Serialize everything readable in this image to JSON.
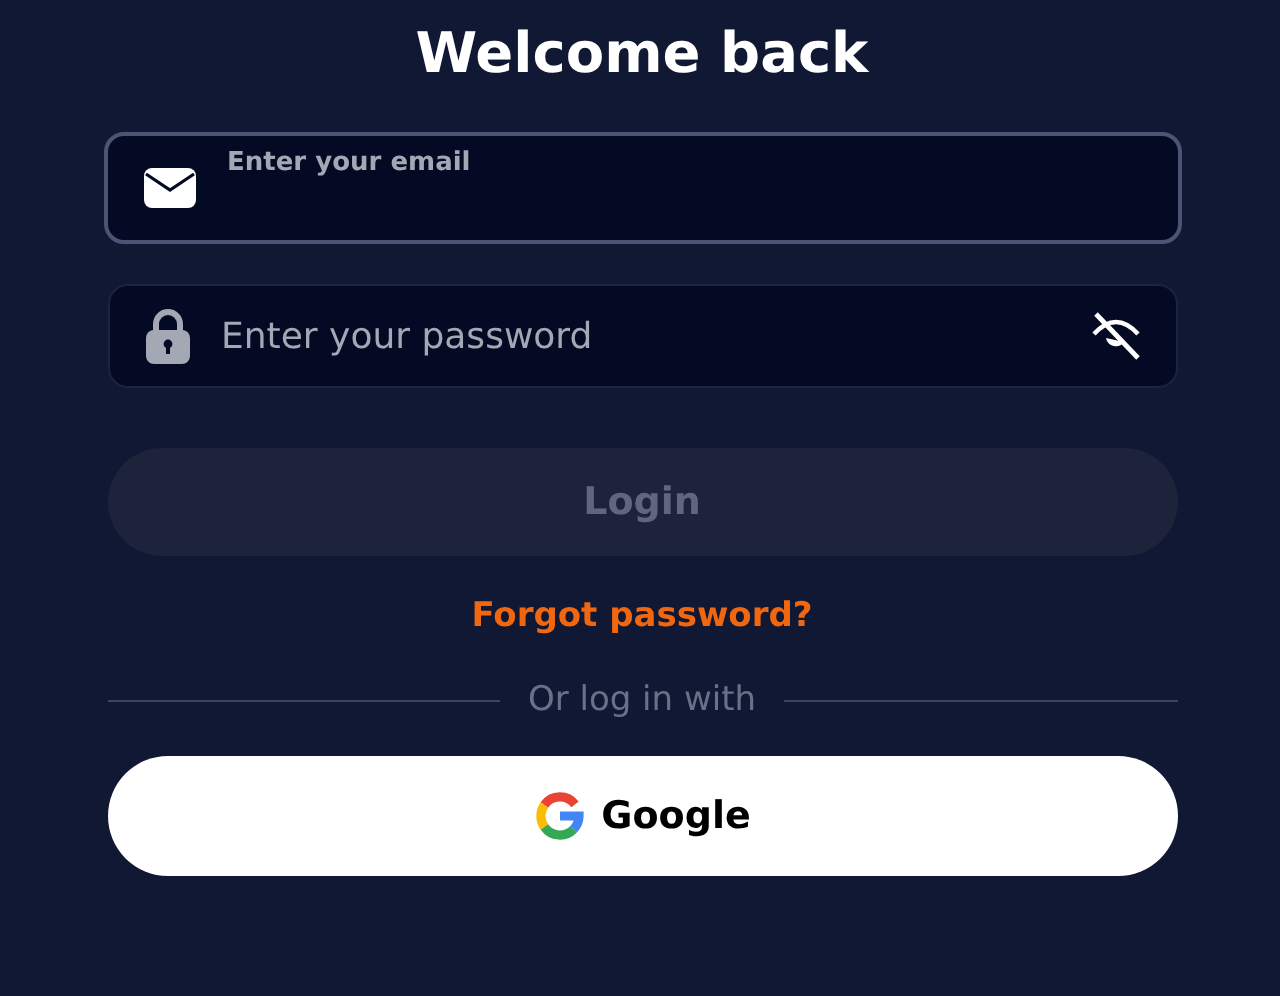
{
  "heading": "Welcome back",
  "email_field": {
    "label": "Enter your email",
    "focused": true
  },
  "password_field": {
    "placeholder": "Enter your password",
    "password_visible": false
  },
  "login_button": {
    "label": "Login",
    "disabled": true
  },
  "forgot_link": "Forgot password?",
  "divider_text": "Or log in with",
  "social_buttons": [
    {
      "kind": "google",
      "label": "Google"
    }
  ]
}
